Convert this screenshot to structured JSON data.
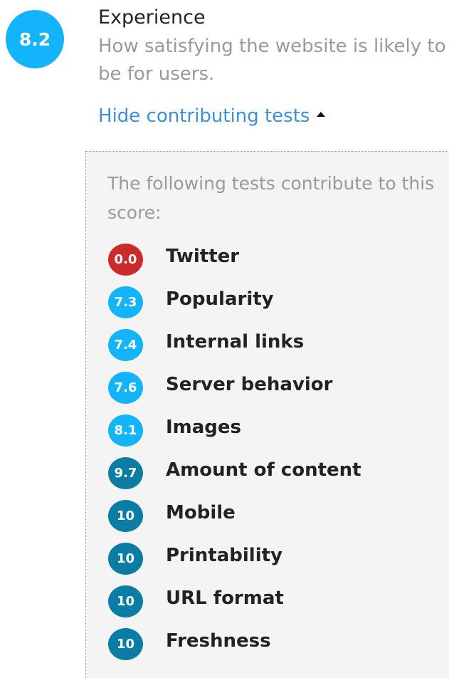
{
  "category": {
    "score": "8.2",
    "title": "Experience",
    "description": "How satisfying the website is likely to be for users.",
    "toggle_label": "Hide contributing tests"
  },
  "panel": {
    "intro": "The following tests contribute to this score:",
    "tests": [
      {
        "score": "0.0",
        "label": "Twitter",
        "color": "#cc2b2b"
      },
      {
        "score": "7.3",
        "label": "Popularity",
        "color": "#14b4fa"
      },
      {
        "score": "7.4",
        "label": "Internal links",
        "color": "#14b4fa"
      },
      {
        "score": "7.6",
        "label": "Server behavior",
        "color": "#14b4fa"
      },
      {
        "score": "8.1",
        "label": "Images",
        "color": "#14b4fa"
      },
      {
        "score": "9.7",
        "label": "Amount of content",
        "color": "#0b7da4"
      },
      {
        "score": "10",
        "label": "Mobile",
        "color": "#0b7da4"
      },
      {
        "score": "10",
        "label": "Printability",
        "color": "#0b7da4"
      },
      {
        "score": "10",
        "label": "URL format",
        "color": "#0b7da4"
      },
      {
        "score": "10",
        "label": "Freshness",
        "color": "#0b7da4"
      }
    ]
  },
  "colors": {
    "badge_primary": "#14b4fa",
    "link": "#3d8fd9",
    "muted_text": "#9a9a9a",
    "panel_bg": "#f4f4f4"
  }
}
